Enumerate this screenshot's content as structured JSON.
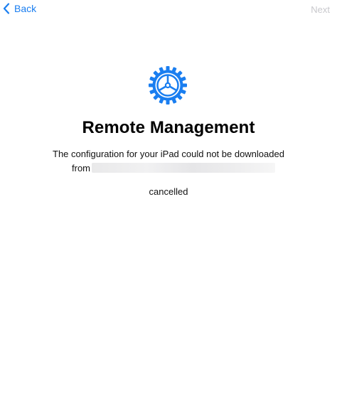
{
  "nav": {
    "back_label": "Back",
    "next_label": "Next"
  },
  "main": {
    "icon": "gear-icon",
    "title": "Remote Management",
    "message": "The configuration for your iPad could not be downloaded",
    "from_prefix": "from",
    "status": "cancelled"
  },
  "colors": {
    "accent": "#1a7ef0",
    "disabled": "#c8c8cc",
    "text": "#000000"
  }
}
